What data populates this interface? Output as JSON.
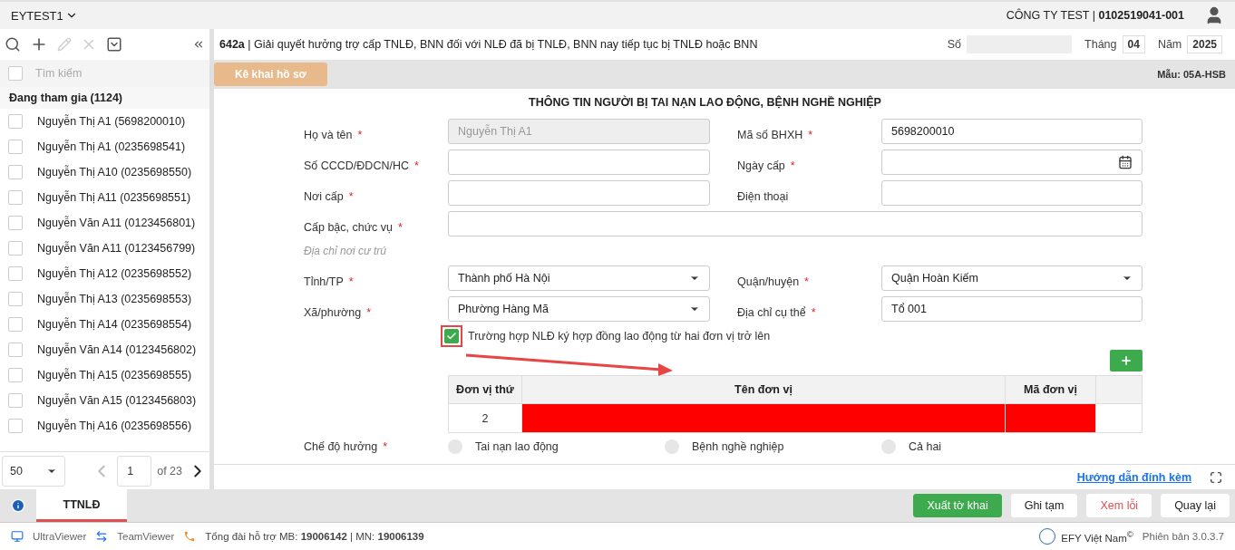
{
  "header": {
    "account": "EYTEST1",
    "company": "CÔNG TY TEST |",
    "tax_code": "0102519041-001"
  },
  "sidebar": {
    "search": {
      "placeholder": "Tìm kiếm",
      "checked": false
    },
    "group": "Đang tham gia (1124)",
    "items": [
      {
        "label": "Nguyễn Thị A1 (5698200010)",
        "checked": false
      },
      {
        "label": "Nguyễn Thị A1 (0235698541)",
        "checked": false
      },
      {
        "label": "Nguyễn Thị A10 (0235698550)",
        "checked": false
      },
      {
        "label": "Nguyễn Thị A11 (0235698551)",
        "checked": false
      },
      {
        "label": "Nguyễn Văn A11 (0123456801)",
        "checked": false
      },
      {
        "label": "Nguyễn Văn A11 (0123456799)",
        "checked": false
      },
      {
        "label": "Nguyễn Thị A12 (0235698552)",
        "checked": false
      },
      {
        "label": "Nguyễn Thị A13 (0235698553)",
        "checked": false
      },
      {
        "label": "Nguyễn Thị A14 (0235698554)",
        "checked": false
      },
      {
        "label": "Nguyễn Văn A14 (0123456802)",
        "checked": false
      },
      {
        "label": "Nguyễn Thị A15 (0235698555)",
        "checked": false
      },
      {
        "label": "Nguyễn Văn A15 (0123456803)",
        "checked": false
      },
      {
        "label": "Nguyễn Thị A16 (0235698556)",
        "checked": false
      }
    ],
    "pagination": {
      "page_size": "50",
      "page": "1",
      "total": "of 23"
    }
  },
  "document": {
    "code": "642a",
    "title": "| Giải quyết hưởng trợ cấp TNLĐ, BNN đối với NLĐ đã bị TNLĐ, BNN nay tiếp tục bị TNLĐ hoặc BNN",
    "number_label": "Số",
    "month_label": "Tháng",
    "month": "04",
    "year_label": "Năm",
    "year": "2025"
  },
  "toolbar": {
    "button": "Kê khai hồ sơ",
    "form_code": "Mẫu: 05A-HSB"
  },
  "form": {
    "title": "THÔNG TIN NGƯỜI BỊ TAI NẠN LAO ĐỘNG, BỆNH NGHỀ NGHIỆP",
    "rows": [
      {
        "kind": "pair",
        "fields": [
          {
            "label": "Họ và tên",
            "required_mark": "*",
            "kind": "text",
            "value": "Nguyễn Thị A1",
            "disabled": true
          },
          {
            "label": "Mã số BHXH",
            "required_mark": "*",
            "kind": "text",
            "value": "5698200010",
            "disabled": false
          }
        ]
      },
      {
        "kind": "pair",
        "fields": [
          {
            "label": "Số CCCD/ĐDCN/HC",
            "required_mark": "*",
            "kind": "text",
            "disabled": false
          },
          {
            "label": "Ngày cấp",
            "required_mark": "*",
            "kind": "date",
            "disabled": false
          }
        ]
      },
      {
        "kind": "pair",
        "fields": [
          {
            "label": "Nơi cấp",
            "required_mark": "*",
            "kind": "text",
            "disabled": false
          },
          {
            "label": "Điện thoại",
            "kind": "text",
            "disabled": false
          }
        ]
      },
      {
        "kind": "wide",
        "fields": [
          {
            "label": "Cấp bậc, chức vụ",
            "required_mark": "*",
            "kind": "text",
            "disabled": false
          }
        ]
      },
      {
        "kind": "section",
        "label": "Địa chỉ nơi cư trú"
      },
      {
        "kind": "pair",
        "fields": [
          {
            "label": "Tỉnh/TP",
            "required_mark": "*",
            "kind": "select",
            "value": "Thành phố Hà Nội",
            "disabled": false
          },
          {
            "label": "Quận/huyện",
            "required_mark": "*",
            "kind": "select",
            "value": "Quận Hoàn Kiếm",
            "disabled": false
          }
        ]
      },
      {
        "kind": "pair",
        "fields": [
          {
            "label": "Xã/phường",
            "required_mark": "*",
            "kind": "select",
            "value": "Phường Hàng Mã",
            "disabled": false
          },
          {
            "label": "Địa chỉ cụ thể",
            "required_mark": "*",
            "kind": "text",
            "value": "Tổ 001",
            "disabled": false
          }
        ]
      }
    ],
    "multi_employer": {
      "label": "Trường hợp NLĐ ký hợp đồng lao động từ hai đơn vị trở lên",
      "checked": true
    },
    "table": {
      "columns": [
        "Đơn vị thứ",
        "Tên đơn vị",
        "Mã đơn vị"
      ],
      "rows": [
        {
          "cells": [
            {
              "value": "2",
              "error": false
            },
            {
              "error": true
            },
            {
              "error": true
            }
          ]
        }
      ]
    },
    "benefit": {
      "label": "Chế độ hưởng",
      "required_mark": "*",
      "options": [
        {
          "label": "Tai nạn lao động",
          "selected": false
        },
        {
          "label": "Bệnh nghề nghiệp",
          "selected": false
        },
        {
          "label": "Cả hai",
          "selected": false
        }
      ]
    }
  },
  "guide_link": "Hướng dẫn đính kèm",
  "tabs": [
    {
      "label": "TTNLĐ",
      "selected": true
    }
  ],
  "buttons": [
    {
      "label": "Xuất tờ khai",
      "kind": "primary"
    },
    {
      "label": "Ghi tạm",
      "kind": "default"
    },
    {
      "label": "Xem lỗi",
      "kind": "danger"
    },
    {
      "label": "Quay lại",
      "kind": "default"
    }
  ],
  "status_bar": {
    "tools": [
      "UltraViewer",
      "TeamViewer"
    ],
    "support": "Tổng đài hỗ trợ MB: **19006142** | MN: **19006139**",
    "brand": "EFY Việt Nam$^{©}$",
    "version": "Phiên bản 3.0.3.7"
  }
}
